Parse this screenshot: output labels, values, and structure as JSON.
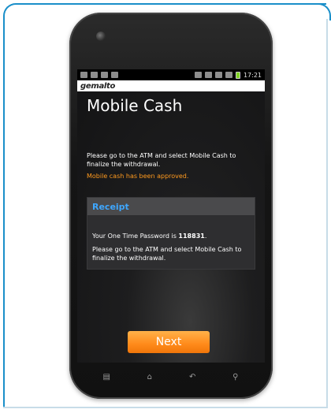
{
  "statusbar": {
    "time": "17:21"
  },
  "brand": {
    "name": "gemalto"
  },
  "screen": {
    "title": "Mobile Cash",
    "instruction": "Please go to the ATM and select Mobile Cash to finalize the withdrawal.",
    "approved_text": "Mobile cash has been approved."
  },
  "receipt": {
    "title": "Receipt",
    "otp_prefix": "Your One Time Password is ",
    "otp_value": "118831",
    "otp_suffix": ".",
    "message": "Please go to the ATM and select Mobile Cash to finalize the withdrawal."
  },
  "actions": {
    "next_label": "Next"
  },
  "navbar": {
    "menu_glyph": "▤",
    "home_glyph": "⌂",
    "back_glyph": "↶",
    "search_glyph": "⚲"
  },
  "colors": {
    "accent_orange": "#ff8a1a",
    "receipt_blue": "#3ea7ff",
    "frame_blue": "#1a8fc9"
  }
}
